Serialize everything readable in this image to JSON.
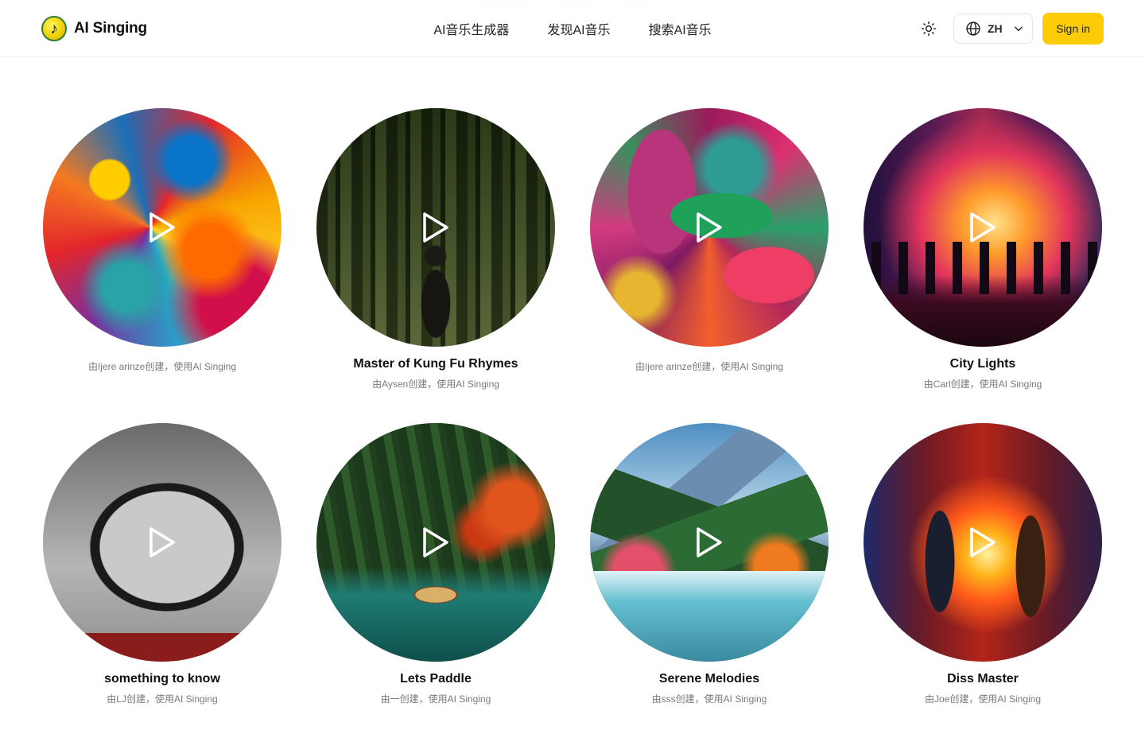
{
  "header": {
    "brand_name": "AI Singing",
    "logo_icon": "music-note-icon",
    "nav": [
      {
        "label": "AI音乐生成器"
      },
      {
        "label": "发现AI音乐"
      },
      {
        "label": "搜索AI音乐"
      }
    ],
    "theme_icon": "sun-icon",
    "language": {
      "code": "ZH",
      "icon": "globe-icon"
    },
    "sign_in_label": "Sign in"
  },
  "colors": {
    "accent": "#fccc07",
    "text": "#111111",
    "muted": "#7a7a7a",
    "border": "#eeeeee"
  },
  "songs": [
    {
      "title": "",
      "credit": "由Ijere arinze创建，使用AI Singing"
    },
    {
      "title": "Master of Kung Fu Rhymes",
      "credit": "由Aysen创建，使用AI Singing"
    },
    {
      "title": "",
      "credit": "由Ijere arinze创建，使用AI Singing"
    },
    {
      "title": "City Lights",
      "credit": "由Carl创建，使用AI Singing"
    },
    {
      "title": "something to know",
      "credit": "由LJ创建，使用AI Singing"
    },
    {
      "title": "Lets Paddle",
      "credit": "由一创建，使用AI Singing"
    },
    {
      "title": "Serene Melodies",
      "credit": "由sss创建，使用AI Singing"
    },
    {
      "title": "Diss Master",
      "credit": "由Joe创建，使用AI Singing"
    }
  ]
}
